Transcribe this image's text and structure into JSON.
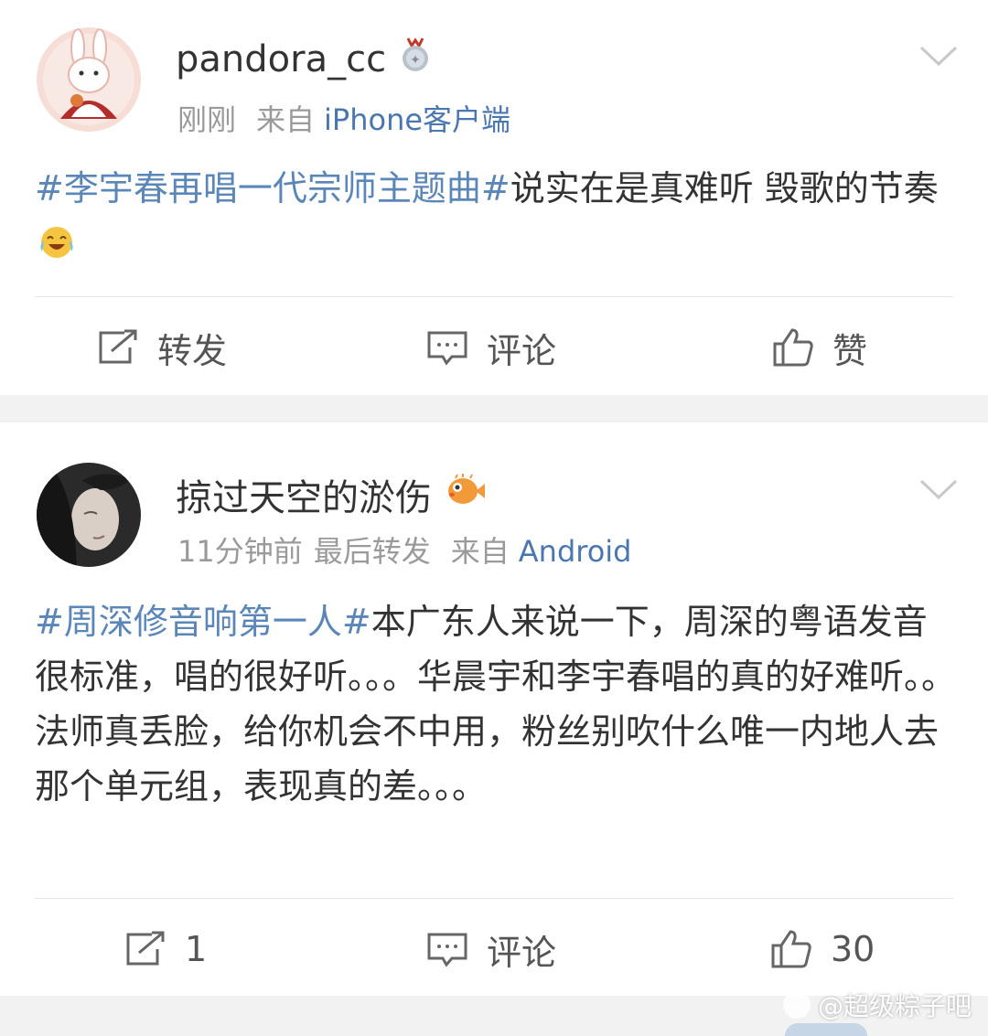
{
  "posts": [
    {
      "username": "pandora_cc",
      "badge_icon": "medal-badge-icon",
      "time": "刚刚",
      "source_prefix": "来自",
      "source": "iPhone客户端",
      "content": {
        "hashtag": "#李宇春再唱一代宗师主题曲#",
        "text": "说实在是真难听 毁歌的节奏",
        "emoji_icon": "laughing-crying-emoji-icon"
      },
      "actions": {
        "repost": "转发",
        "comment": "评论",
        "like": "赞"
      }
    },
    {
      "username": "掠过天空的淤伤",
      "badge_icon": "pufferfish-badge-icon",
      "time": "11分钟前",
      "status": "最后转发",
      "source_prefix": "来自",
      "source": "Android",
      "content": {
        "hashtag": "#周深修音响第一人#",
        "text": "本广东人来说一下，周深的粤语发音很标准，唱的很好听。。。华晨宇和李宇春唱的真的好难听。。法师真丢脸，给你机会不中用，粉丝别吹什么唯一内地人去那个单元组，表现真的差。。。"
      },
      "actions": {
        "repost": "1",
        "comment": "评论",
        "like": "30"
      }
    }
  ],
  "watermark": "@超级粽子吧",
  "colors": {
    "hashtag": "#5b86b8",
    "source_link": "#4b77b0",
    "meta": "#9a9a9a",
    "separator": "#f2f2f2"
  }
}
